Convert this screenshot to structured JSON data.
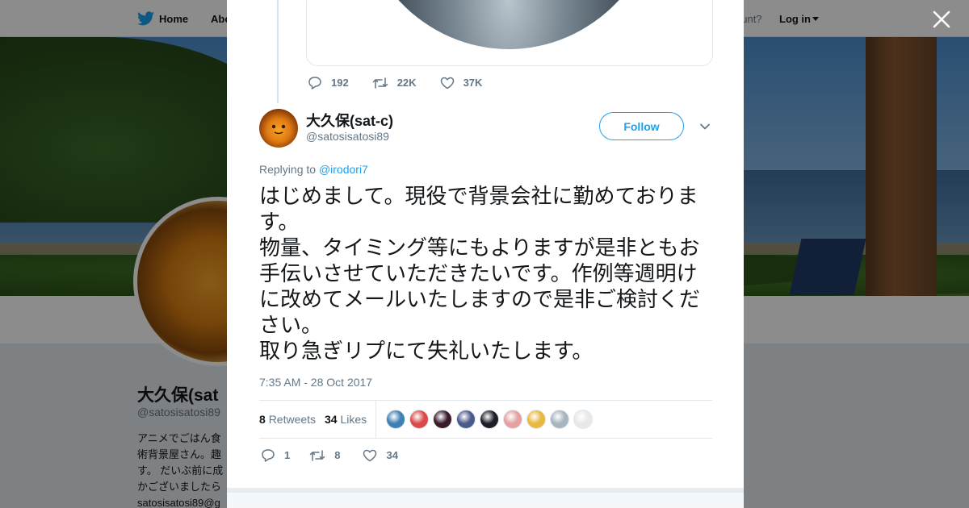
{
  "nav": {
    "home": "Home",
    "about": "Abo",
    "account_prompt": "ccount?",
    "login": "Log in"
  },
  "background_profile": {
    "name": "大久保(sat",
    "handle": "@satosisatosi89",
    "bio_lines": [
      "アニメでごはん食",
      "術背景屋さん。趣",
      "す。 だいぶ前に成",
      "かございましたら",
      "satosisatosi89@g"
    ]
  },
  "modal": {
    "previous_tweet_actions": {
      "replies": "192",
      "retweets": "22K",
      "likes": "37K"
    },
    "tweet": {
      "author_name": "大久保(sat-c)",
      "author_handle": "@satosisatosi89",
      "follow_label": "Follow",
      "replying_prefix": "Replying to",
      "replying_to": "@irodori7",
      "text": "はじめまして。現役で背景会社に勤めております。\n物量、タイミング等にもよりますが是非ともお手伝いさせていただきたいです。作例等週明けに改めてメールいたしますので是非ご検討ください。\n取り急ぎリプにて失礼いたします。",
      "timestamp": "7:35 AM - 28 Oct 2017",
      "retweet_count": "8",
      "retweet_label": "Retweets",
      "like_count": "34",
      "like_label": "Likes",
      "actions": {
        "replies": "1",
        "retweets": "8",
        "likes": "34"
      }
    },
    "liker_colors": [
      "#3f7fb3",
      "#d94a4a",
      "#3a1a2a",
      "#4a5a8a",
      "#1e1e2a",
      "#e6a0a0",
      "#e8b840",
      "#a8b4bf",
      "#e8e8e8"
    ]
  },
  "colors": {
    "accent": "#1da1f2",
    "text": "#14171a",
    "secondary": "#657786"
  }
}
